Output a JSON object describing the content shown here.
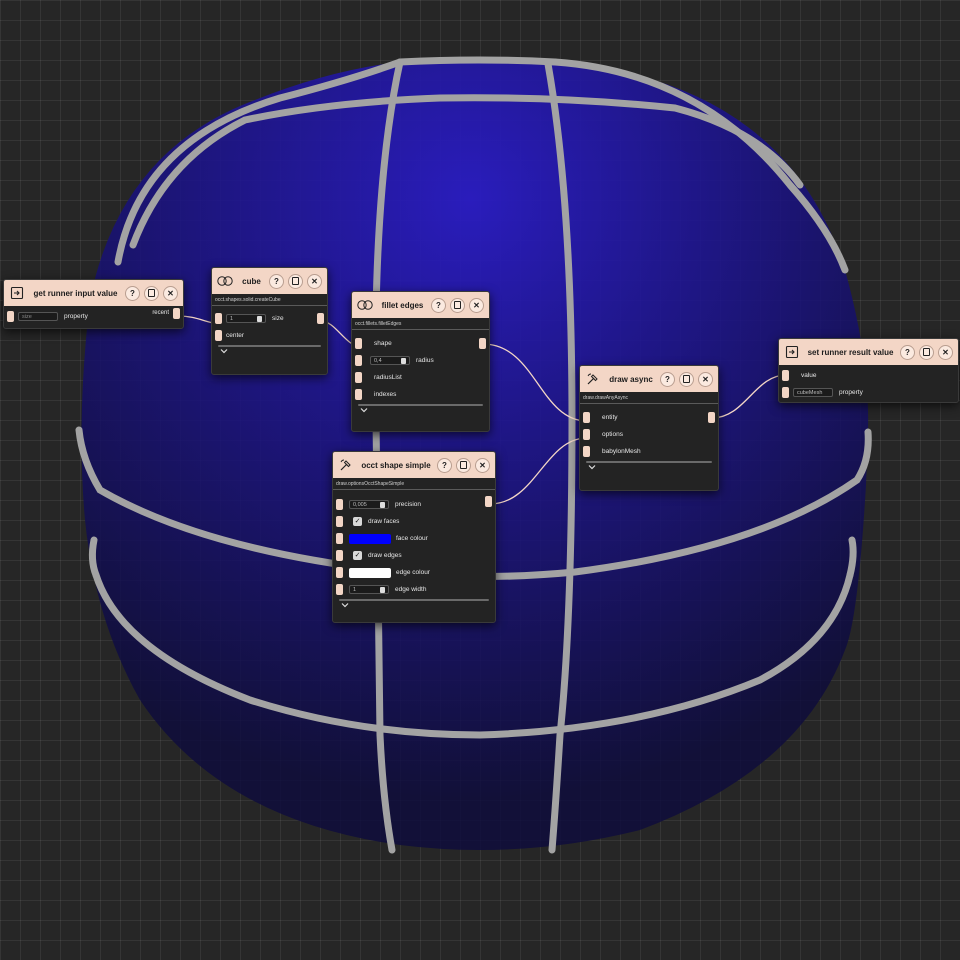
{
  "colors": {
    "node_header": "#f3d6c6",
    "socket": "#f3d6c6",
    "wire": "#f3d6c6",
    "face_colour": "#0000ff",
    "edge_colour": "#ffffff"
  },
  "nodes": {
    "get_input": {
      "title": "get runner input value",
      "icon": "input-icon",
      "property_value": "size",
      "property_label": "property",
      "output_label": "recent"
    },
    "cube": {
      "title": "cube",
      "icon": "shape-icon",
      "subtitle": "occt.shapes.solid.createCube",
      "size_value": "1",
      "size_label": "size",
      "center_label": "center"
    },
    "fillet": {
      "title": "fillet edges",
      "icon": "shape-icon",
      "subtitle": "occt.fillets.filletEdges",
      "shape_label": "shape",
      "radius_value": "0,4",
      "radius_label": "radius",
      "radius_list_label": "radiusList",
      "indexes_label": "indexes"
    },
    "draw_async": {
      "title": "draw async",
      "icon": "draw-icon",
      "subtitle": "draw.drawAnyAsync",
      "entity_label": "entity",
      "options_label": "options",
      "mesh_label": "babylonMesh"
    },
    "set_result": {
      "title": "set runner result value",
      "icon": "output-icon",
      "value_label": "value",
      "property_value": "cubeMesh",
      "property_label": "property"
    },
    "occt_shape": {
      "title": "occt shape simple",
      "icon": "draw-icon",
      "subtitle": "draw.optionsOcctShapeSimple",
      "precision_value": "0,005",
      "precision_label": "precision",
      "draw_faces_label": "draw faces",
      "face_colour_label": "face colour",
      "draw_edges_label": "draw edges",
      "edge_colour_label": "edge colour",
      "edge_width_value": "1",
      "edge_width_label": "edge width"
    }
  }
}
